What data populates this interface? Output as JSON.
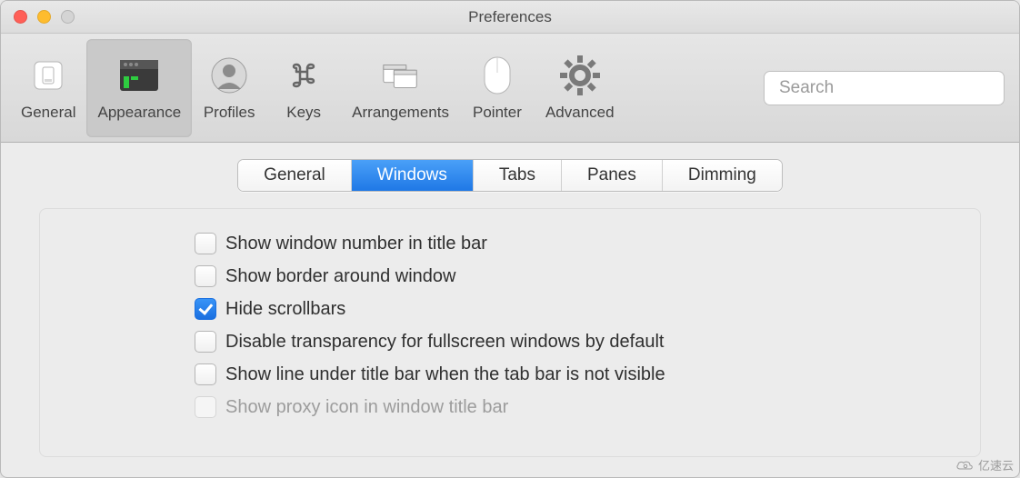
{
  "window": {
    "title": "Preferences"
  },
  "toolbar": {
    "items": [
      {
        "id": "general",
        "label": "General"
      },
      {
        "id": "appearance",
        "label": "Appearance"
      },
      {
        "id": "profiles",
        "label": "Profiles"
      },
      {
        "id": "keys",
        "label": "Keys"
      },
      {
        "id": "arrangements",
        "label": "Arrangements"
      },
      {
        "id": "pointer",
        "label": "Pointer"
      },
      {
        "id": "advanced",
        "label": "Advanced"
      }
    ],
    "active_index": 1
  },
  "search": {
    "placeholder": "Search",
    "value": ""
  },
  "tabs": {
    "items": [
      "General",
      "Windows",
      "Tabs",
      "Panes",
      "Dimming"
    ],
    "selected_index": 1
  },
  "options": [
    {
      "label": "Show window number in title bar",
      "checked": false,
      "disabled": false
    },
    {
      "label": "Show border around window",
      "checked": false,
      "disabled": false
    },
    {
      "label": "Hide scrollbars",
      "checked": true,
      "disabled": false
    },
    {
      "label": "Disable transparency for fullscreen windows by default",
      "checked": false,
      "disabled": false
    },
    {
      "label": "Show line under title bar when the tab bar is not visible",
      "checked": false,
      "disabled": false
    },
    {
      "label": "Show proxy icon in window title bar",
      "checked": false,
      "disabled": true
    }
  ],
  "watermark": {
    "text": "亿速云"
  }
}
